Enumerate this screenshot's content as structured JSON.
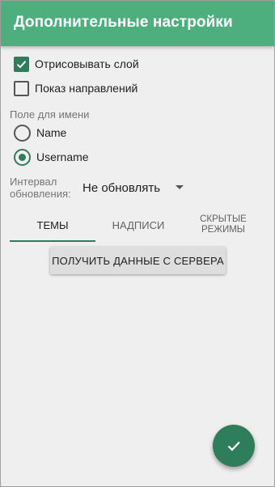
{
  "appbar": {
    "title": "Дополнительные настройки"
  },
  "checkboxes": [
    {
      "label": "Отрисовывать слой",
      "checked": true
    },
    {
      "label": "Показ направлений",
      "checked": false
    }
  ],
  "name_field": {
    "label": "Поле для имени",
    "options": [
      {
        "label": "Name",
        "selected": false
      },
      {
        "label": "Username",
        "selected": true
      }
    ]
  },
  "interval": {
    "label": "Интервал обновления:",
    "value": "Не обновлять"
  },
  "tabs": [
    {
      "label": "Темы",
      "active": true
    },
    {
      "label": "Надписи",
      "active": false
    },
    {
      "label": "Скрытые режимы",
      "active": false
    }
  ],
  "fetch_button": {
    "label": "ПОЛУЧИТЬ ДАННЫЕ С СЕРВЕРА"
  },
  "fab": {
    "icon": "check-icon"
  },
  "colors": {
    "appbar": "#4caf7d",
    "accent": "#2e7d5b",
    "background": "#efefef"
  }
}
